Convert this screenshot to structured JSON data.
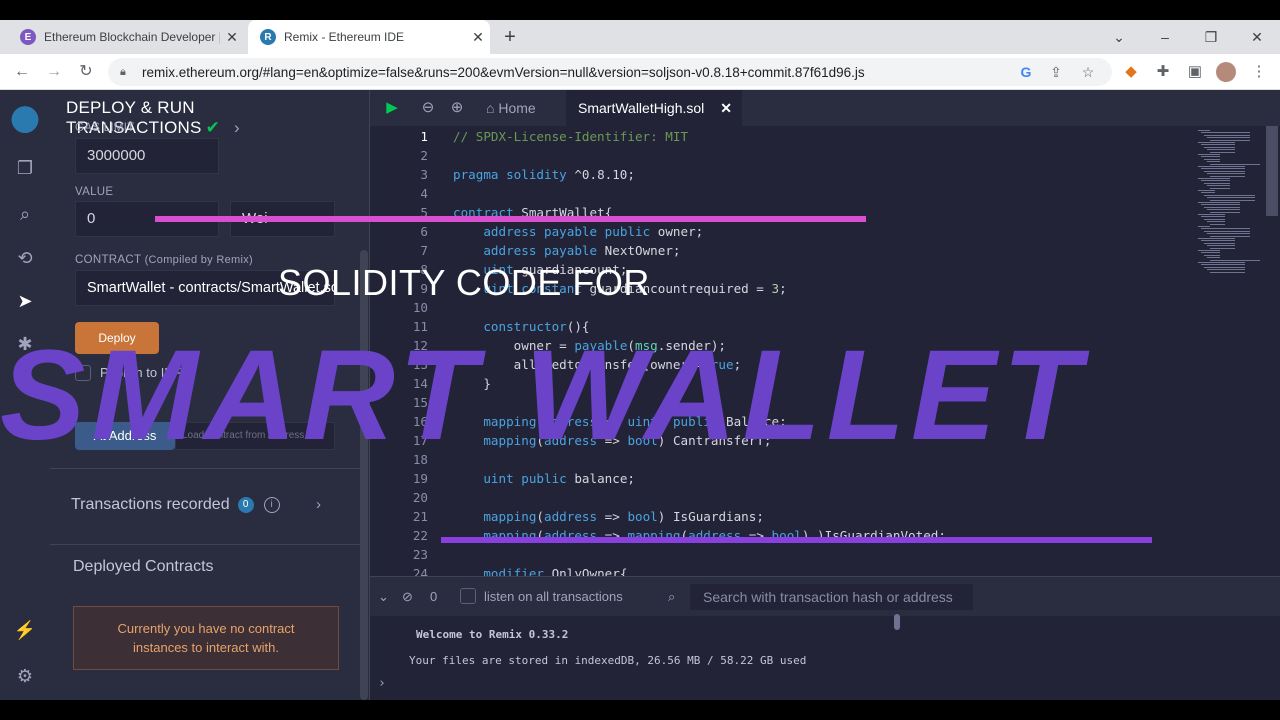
{
  "browser": {
    "tabs": [
      {
        "title": "Ethereum Blockchain Developer |",
        "favicon": "E"
      },
      {
        "title": "Remix - Ethereum IDE",
        "favicon": "R"
      }
    ],
    "new_tab": "+",
    "window_controls": {
      "expand": "⌄",
      "minimize": "–",
      "restore": "❐",
      "close": "✕"
    },
    "url": "remix.ethereum.org/#lang=en&optimize=false&runs=200&evmVersion=null&version=soljson-v0.8.18+commit.87f61d96.js"
  },
  "panel": {
    "title": "DEPLOY & RUN TRANSACTIONS",
    "gas_limit_label": "GAS LIMIT",
    "gas_limit_value": "3000000",
    "value_label": "VALUE",
    "value_amount": "0",
    "value_unit": "Wei",
    "contract_label": "CONTRACT",
    "contract_sub": "(Compiled by Remix)",
    "contract_selected": "SmartWallet - contracts/SmartWallet.sol",
    "deploy_label": "Deploy",
    "publish_ipfs_label": "Publish to IPFS",
    "at_address_label": "At Address",
    "at_address_placeholder": "Load contract from Address",
    "transactions_recorded_label": "Transactions recorded",
    "transactions_count": "0",
    "deployed_contracts_label": "Deployed Contracts",
    "no_contracts_line1": "Currently you have no contract",
    "no_contracts_line2": "instances to interact with."
  },
  "editor": {
    "home_tab": "Home",
    "file_tab": "SmartWalletHigh.sol",
    "current_line": 1,
    "lines": [
      {
        "n": "1",
        "html": "<span class='c'>// SPDX-License-Identifier: MIT</span>"
      },
      {
        "n": "2",
        "html": ""
      },
      {
        "n": "3",
        "html": "<span class='k'>pragma solidity</span> ^0.8.10;"
      },
      {
        "n": "4",
        "html": ""
      },
      {
        "n": "5",
        "html": "<span class='k'>contract</span> SmartWallet{"
      },
      {
        "n": "6",
        "html": "    <span class='k'>address payable public</span> owner;"
      },
      {
        "n": "7",
        "html": "    <span class='k'>address payable</span> NextOwner;"
      },
      {
        "n": "8",
        "html": "    <span class='k'>uint</span> guardiancount;"
      },
      {
        "n": "9",
        "html": "    <span class='k'>uint constant</span> guardiancountrequired = <span class='n'>3</span>;"
      },
      {
        "n": "10",
        "html": ""
      },
      {
        "n": "11",
        "html": "    <span class='k'>constructor</span>(){"
      },
      {
        "n": "12",
        "html": "        owner = <span class='k'>payable</span>(<span class='g'>msg</span>.sender);"
      },
      {
        "n": "13",
        "html": "        allowedtoTransfer[owner]=<span class='k'>true</span>;"
      },
      {
        "n": "14",
        "html": "    }"
      },
      {
        "n": "15",
        "html": ""
      },
      {
        "n": "16",
        "html": "    <span class='k'>mapping</span>(<span class='k'>address</span> => <span class='k'>uint</span>) <span class='k'>public</span> Balance;"
      },
      {
        "n": "17",
        "html": "    <span class='k'>mapping</span>(<span class='k'>address</span> => <span class='k'>bool</span>) CantransferT;"
      },
      {
        "n": "18",
        "html": ""
      },
      {
        "n": "19",
        "html": "    <span class='k'>uint public</span> balance;"
      },
      {
        "n": "20",
        "html": ""
      },
      {
        "n": "21",
        "html": "    <span class='k'>mapping</span>(<span class='k'>address</span> => <span class='k'>bool</span>) IsGuardians;"
      },
      {
        "n": "22",
        "html": "    <span class='k'>mapping</span>(<span class='k'>address</span> => <span class='k'>mapping</span>(<span class='k'>address</span> => <span class='k'>bool</span>) )IsGuardianVoted;"
      },
      {
        "n": "23",
        "html": ""
      },
      {
        "n": "24",
        "html": "    <span class='k'>modifier</span> OnlyOwner{"
      }
    ]
  },
  "terminal": {
    "count": "0",
    "listen_label": "listen on all transactions",
    "search_placeholder": "Search with transaction hash or address",
    "welcome": "Welcome to Remix 0.33.2",
    "storage": "Your files are stored in indexedDB, 26.56 MB / 58.22 GB used",
    "prompt": "›"
  },
  "overlay": {
    "subtitle": "SOLIDITY CODE FOR",
    "title": "SMART WALLET",
    "title_color": "#6a43c9",
    "line_pink": "#d94fd0",
    "line_purple": "#8a3fe0"
  },
  "icons": {
    "extensions": [
      "metamask-icon",
      "puzzle-icon",
      "sidebar-icon",
      "profile-avatar",
      "kebab-menu-icon"
    ]
  }
}
